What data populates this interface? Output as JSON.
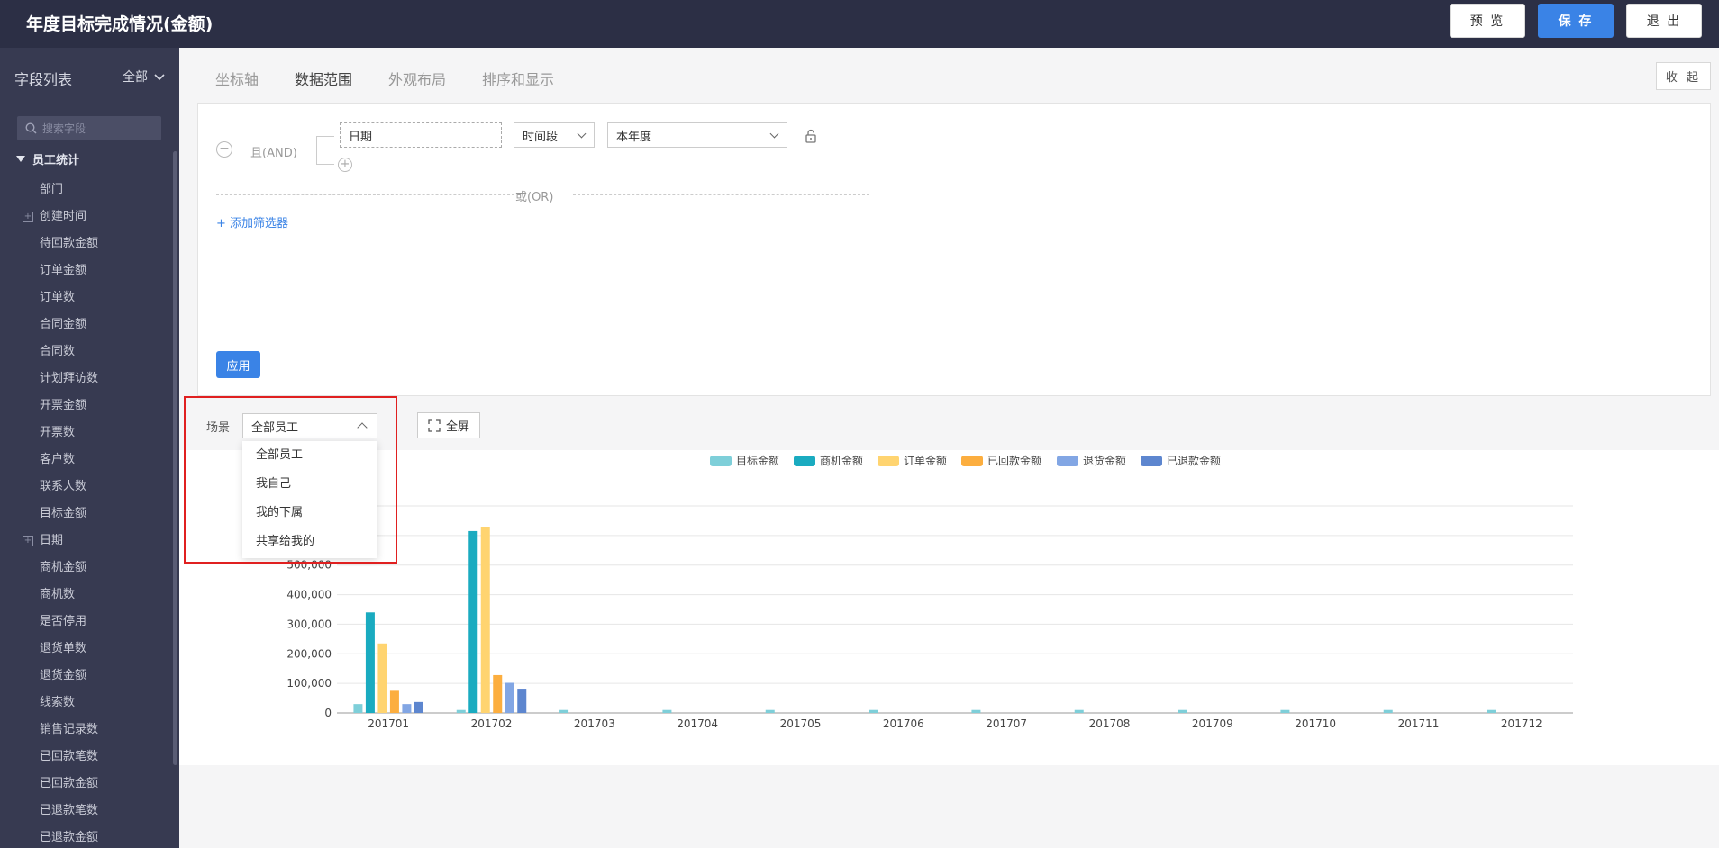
{
  "header": {
    "title": "年度目标完成情况(金额)",
    "preview_label": "预 览",
    "save_label": "保 存",
    "exit_label": "退 出"
  },
  "sidebar": {
    "title": "字段列表",
    "filter_label": "全部",
    "search_placeholder": "搜索字段",
    "group_label": "员工统计",
    "items": [
      {
        "label": "部门",
        "expandable": false
      },
      {
        "label": "创建时间",
        "expandable": true
      },
      {
        "label": "待回款金额",
        "expandable": false
      },
      {
        "label": "订单金额",
        "expandable": false
      },
      {
        "label": "订单数",
        "expandable": false
      },
      {
        "label": "合同金额",
        "expandable": false
      },
      {
        "label": "合同数",
        "expandable": false
      },
      {
        "label": "计划拜访数",
        "expandable": false
      },
      {
        "label": "开票金额",
        "expandable": false
      },
      {
        "label": "开票数",
        "expandable": false
      },
      {
        "label": "客户数",
        "expandable": false
      },
      {
        "label": "联系人数",
        "expandable": false
      },
      {
        "label": "目标金额",
        "expandable": false
      },
      {
        "label": "日期",
        "expandable": true
      },
      {
        "label": "商机金额",
        "expandable": false
      },
      {
        "label": "商机数",
        "expandable": false
      },
      {
        "label": "是否停用",
        "expandable": false
      },
      {
        "label": "退货单数",
        "expandable": false
      },
      {
        "label": "退货金额",
        "expandable": false
      },
      {
        "label": "线索数",
        "expandable": false
      },
      {
        "label": "销售记录数",
        "expandable": false
      },
      {
        "label": "已回款笔数",
        "expandable": false
      },
      {
        "label": "已回款金额",
        "expandable": false
      },
      {
        "label": "已退款笔数",
        "expandable": false
      },
      {
        "label": "已退款金额",
        "expandable": false
      }
    ]
  },
  "tabs": [
    {
      "label": "坐标轴",
      "active": false
    },
    {
      "label": "数据范围",
      "active": true
    },
    {
      "label": "外观布局",
      "active": false
    },
    {
      "label": "排序和显示",
      "active": false
    }
  ],
  "collapse_label": "收 起",
  "filter": {
    "and_label": "且(AND)",
    "field": "日期",
    "operator": "时间段",
    "value": "本年度",
    "or_label": "或(OR)",
    "add_filter_label": "+ 添加筛选器",
    "apply_label": "应用"
  },
  "scene": {
    "label": "场景",
    "selected": "全部员工",
    "options": [
      "全部员工",
      "我自己",
      "我的下属",
      "共享给我的"
    ],
    "fullscreen_label": "全屏"
  },
  "chart_data": {
    "type": "bar",
    "categories": [
      "201701",
      "201702",
      "201703",
      "201704",
      "201705",
      "201706",
      "201707",
      "201708",
      "201709",
      "201710",
      "201711",
      "201712"
    ],
    "series": [
      {
        "name": "目标金额",
        "color": "#7ecfd9",
        "values": [
          30000,
          10000,
          10000,
          10000,
          10000,
          10000,
          10000,
          10000,
          10000,
          10000,
          10000,
          10000
        ]
      },
      {
        "name": "商机金额",
        "color": "#1aabc0",
        "values": [
          340000,
          615000,
          0,
          0,
          0,
          0,
          0,
          0,
          0,
          0,
          0,
          0
        ]
      },
      {
        "name": "订单金额",
        "color": "#ffd470",
        "values": [
          235000,
          630000,
          0,
          0,
          0,
          0,
          0,
          0,
          0,
          0,
          0,
          0
        ]
      },
      {
        "name": "已回款金额",
        "color": "#fcae3f",
        "values": [
          75000,
          128000,
          0,
          0,
          0,
          0,
          0,
          0,
          0,
          0,
          0,
          0
        ]
      },
      {
        "name": "退货金额",
        "color": "#82a6e4",
        "values": [
          30000,
          102000,
          0,
          0,
          0,
          0,
          0,
          0,
          0,
          0,
          0,
          0
        ]
      },
      {
        "name": "已退款金额",
        "color": "#5d86cf",
        "values": [
          37000,
          82000,
          0,
          0,
          0,
          0,
          0,
          0,
          0,
          0,
          0,
          0
        ]
      }
    ],
    "yticks": [
      "0",
      "100,000",
      "200,000",
      "300,000",
      "400,000",
      "500,000"
    ],
    "ylim": [
      0,
      700000
    ],
    "grid": true,
    "legend": "top-center"
  }
}
